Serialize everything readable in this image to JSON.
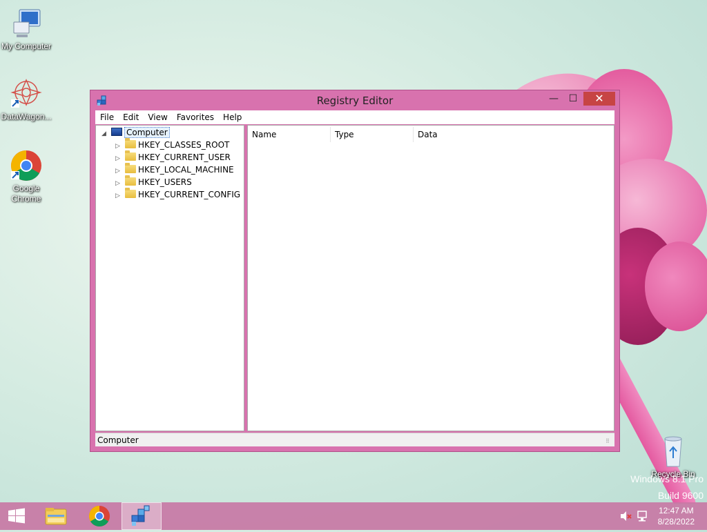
{
  "desktop": {
    "icons": [
      {
        "label": "My Computer",
        "icon": "computer-icon"
      },
      {
        "label": "DataWagon...",
        "icon": "datawagon-icon"
      },
      {
        "label": "Google Chrome",
        "icon": "chrome-icon"
      },
      {
        "label": "Recycle Bin",
        "icon": "recycle-bin-icon"
      }
    ],
    "watermark_line1": "Windows 8.1 Pro",
    "watermark_line2": "Build 9600"
  },
  "window": {
    "title": "Registry Editor",
    "controls": {
      "minimize": "—",
      "maximize": "☐",
      "close": "✕"
    },
    "menu": [
      "File",
      "Edit",
      "View",
      "Favorites",
      "Help"
    ],
    "tree": {
      "root": "Computer",
      "keys": [
        "HKEY_CLASSES_ROOT",
        "HKEY_CURRENT_USER",
        "HKEY_LOCAL_MACHINE",
        "HKEY_USERS",
        "HKEY_CURRENT_CONFIG"
      ]
    },
    "columns": [
      "Name",
      "Type",
      "Data"
    ],
    "status": "Computer"
  },
  "taskbar": {
    "time": "12:47 AM",
    "date": "8/28/2022",
    "apps": [
      "start-button",
      "file-explorer",
      "chrome",
      "registry-editor"
    ],
    "colors": {
      "accent": "#d872ae",
      "close": "#c74444"
    }
  }
}
